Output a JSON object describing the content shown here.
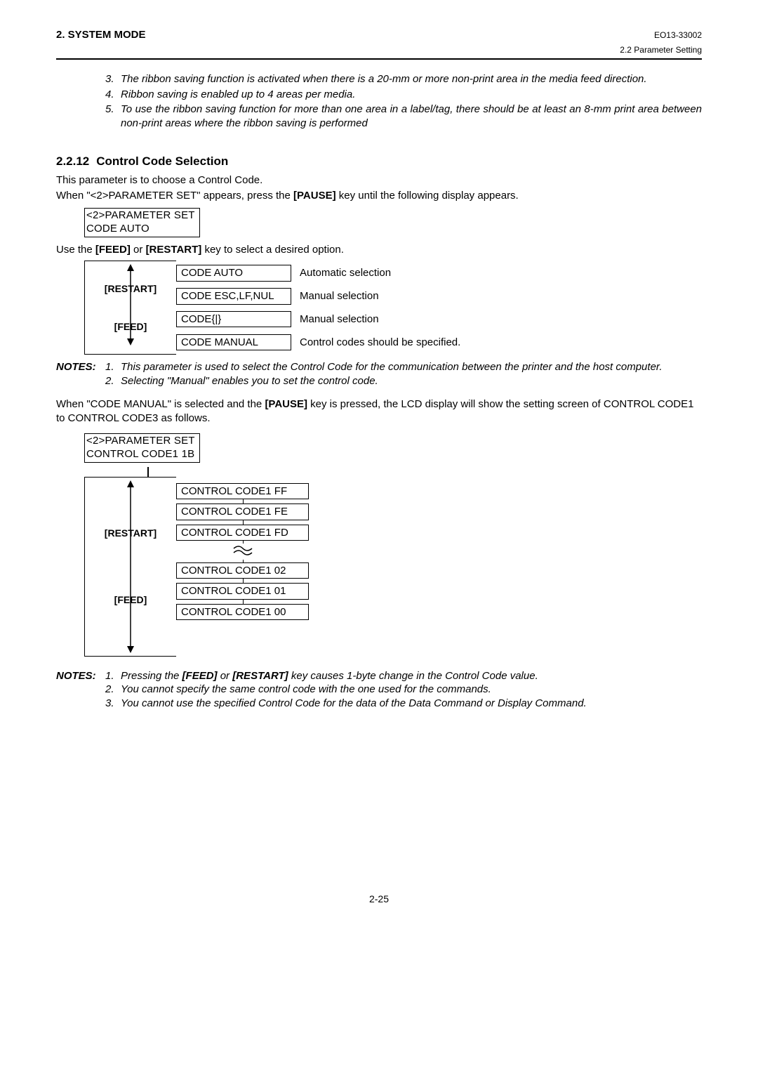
{
  "header": {
    "left": "2. SYSTEM MODE",
    "right": "EO13-33002",
    "sub": "2.2 Parameter Setting"
  },
  "intro_notes": [
    {
      "n": "3.",
      "t": "The ribbon saving function is activated when there is a 20-mm or more non-print area in the media feed direction."
    },
    {
      "n": "4.",
      "t": "Ribbon saving is enabled up to 4 areas per media."
    },
    {
      "n": "5.",
      "t": "To use the ribbon saving function for more than one area in a label/tag, there should be at least an 8-mm print area between non-print areas where the ribbon saving is performed"
    }
  ],
  "section": {
    "num": "2.2.12",
    "title": "Control Code Selection"
  },
  "p1": "This parameter is to choose a Control Code.",
  "p2a": "When \"<2>PARAMETER SET\" appears, press the ",
  "p2b": "[PAUSE]",
  "p2c": " key until the following display appears.",
  "lcd1": {
    "l1": "<2>PARAMETER SET",
    "l2": "CODE  AUTO"
  },
  "p3a": "Use the ",
  "p3b": "[FEED]",
  "p3c": " or ",
  "p3d": "[RESTART]",
  "p3e": " key to select a desired option.",
  "keys": {
    "restart": "[RESTART]",
    "feed": "[FEED]"
  },
  "options": [
    {
      "code": "CODE  AUTO",
      "desc": "Automatic selection"
    },
    {
      "code": "CODE ESC,LF,NUL",
      "desc": "Manual selection"
    },
    {
      "code": "CODE{|}",
      "desc": "Manual selection"
    },
    {
      "code": "CODE MANUAL",
      "desc": "Control codes should be specified."
    }
  ],
  "notes1_label": "NOTES:",
  "notes1": [
    {
      "n": "1.",
      "t": "This parameter is used to select the Control Code for the communication between the printer and the host computer."
    },
    {
      "n": "2.",
      "t": "Selecting \"Manual\" enables you to set the control code."
    }
  ],
  "p4a": "When \"CODE MANUAL\" is selected and the ",
  "p4b": "[PAUSE]",
  "p4c": " key is pressed, the LCD display will show the setting screen of CONTROL CODE1 to CONTROL CODE3 as follows.",
  "lcd2": {
    "l1": "<2>PARAMETER SET",
    "l2": "CONTROL CODE1 1B"
  },
  "codes2_top": [
    "CONTROL CODE1 FF",
    "CONTROL CODE1 FE",
    "CONTROL CODE1 FD"
  ],
  "codes2_bot": [
    "CONTROL CODE1 02",
    "CONTROL CODE1 01",
    "CONTROL CODE1 00"
  ],
  "notes2": [
    {
      "n": "1.",
      "t_a": "Pressing the ",
      "t_b": "[FEED]",
      "t_c": " or ",
      "t_d": "[RESTART]",
      "t_e": " key causes 1-byte change in the Control Code value."
    },
    {
      "n": "2.",
      "t": "You cannot specify the same control code with the one used for the commands."
    },
    {
      "n": "3.",
      "t": "You cannot use the specified Control Code for the data of the Data Command or Display Command."
    }
  ],
  "pagenum": "2-25"
}
